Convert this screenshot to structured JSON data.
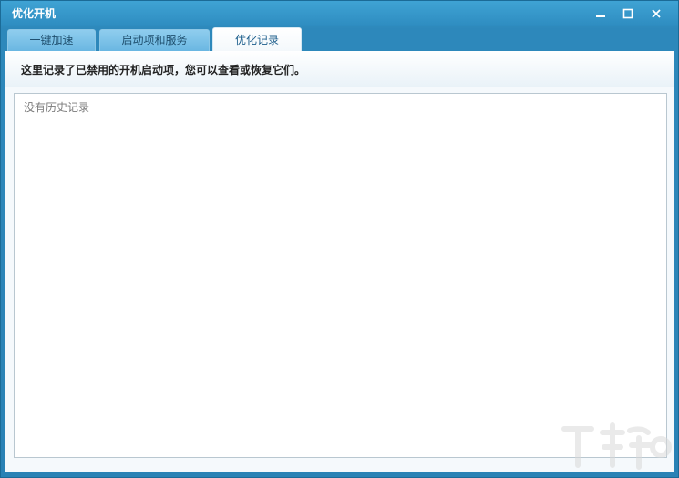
{
  "window": {
    "title": "优化开机"
  },
  "tabs": [
    {
      "label": "一键加速",
      "active": false
    },
    {
      "label": "启动项和服务",
      "active": false
    },
    {
      "label": "优化记录",
      "active": true
    }
  ],
  "panel": {
    "description": "这里记录了已禁用的开机启动项，您可以查看或恢复它们。",
    "empty_text": "没有历史记录"
  },
  "colors": {
    "frame": "#2a82b5",
    "active_tab_text": "#1b5d8b"
  },
  "icons": {
    "minimize": "minimize-icon",
    "maximize": "maximize-icon",
    "close": "close-icon",
    "watermark": "watermark-logo"
  }
}
